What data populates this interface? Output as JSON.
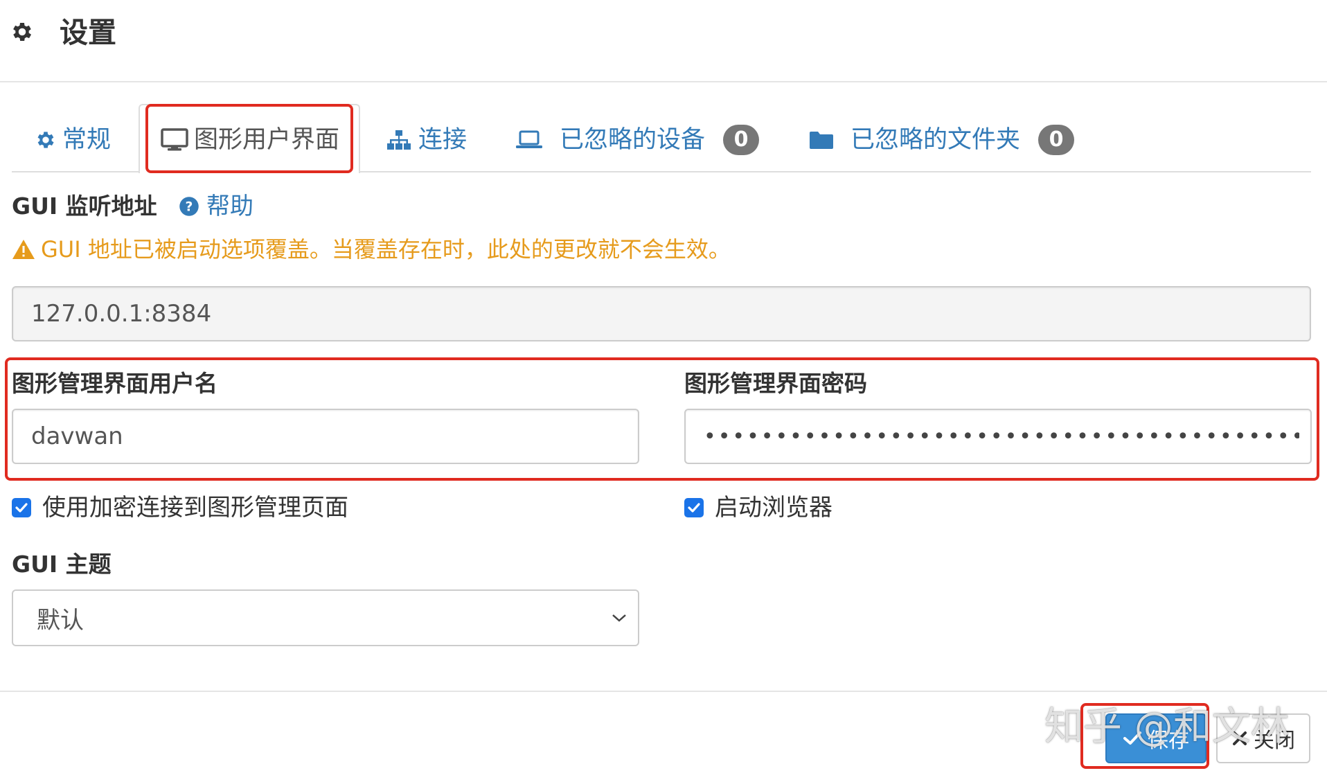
{
  "header": {
    "title": "设置",
    "icon": "gear-icon"
  },
  "tabs": [
    {
      "label": "常规",
      "icon": "gear-icon",
      "active": false
    },
    {
      "label": "图形用户界面",
      "icon": "desktop-icon",
      "active": true
    },
    {
      "label": "连接",
      "icon": "sitemap-icon",
      "active": false
    },
    {
      "label": "已忽略的设备",
      "icon": "laptop-icon",
      "badge": "0",
      "active": false
    },
    {
      "label": "已忽略的文件夹",
      "icon": "folder-icon",
      "badge": "0",
      "active": false
    }
  ],
  "gui_listen": {
    "label": "GUI 监听地址",
    "help_label": "帮助",
    "warning": "GUI 地址已被启动选项覆盖。当覆盖存在时，此处的更改就不会生效。",
    "value": "127.0.0.1:8384"
  },
  "credentials": {
    "username_label": "图形管理界面用户名",
    "username_value": "davwan",
    "password_label": "图形管理界面密码",
    "password_mask": "••••••••••••••••••••••••••••••••••••••••••••••••••••"
  },
  "options": {
    "use_tls_label": "使用加密连接到图形管理页面",
    "use_tls_checked": true,
    "start_browser_label": "启动浏览器",
    "start_browser_checked": true
  },
  "theme": {
    "label": "GUI 主题",
    "selected": "默认"
  },
  "footer": {
    "save_label": "保存",
    "close_label": "关闭"
  },
  "watermark": "知乎 @和文林",
  "colors": {
    "accent": "#337ab7",
    "warning": "#e69b1c",
    "highlight": "#e02b20",
    "primary_button": "#3a8fd6",
    "badge": "#777777"
  }
}
